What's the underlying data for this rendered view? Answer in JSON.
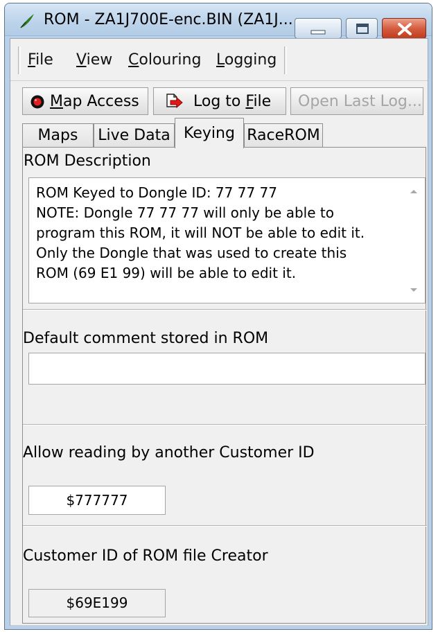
{
  "window": {
    "title": "ROM - ZA1J700E-enc.BIN (ZA1J...",
    "icon": "quill-icon",
    "controls": {
      "minimize": "minimize-icon",
      "maximize": "maximize-icon",
      "close": "close-icon"
    }
  },
  "menubar": {
    "items": [
      {
        "label": "File",
        "access_key": "F"
      },
      {
        "label": "View",
        "access_key": "V"
      },
      {
        "label": "Colouring",
        "access_key": "C"
      },
      {
        "label": "Logging",
        "access_key": "L"
      }
    ]
  },
  "toolbar": {
    "map_access": {
      "label_prefix": "",
      "access_key": "M",
      "label_suffix": "ap Access",
      "icon": "record-icon"
    },
    "log_to_file": {
      "label_prefix": "Log to ",
      "access_key": "F",
      "label_suffix": "ile",
      "icon": "log-arrow-icon"
    },
    "open_last_log": {
      "label": "Open Last Log...",
      "enabled": false
    }
  },
  "tabs": [
    {
      "label": "Maps"
    },
    {
      "label": "Live Data"
    },
    {
      "label": "Keying",
      "active": true
    },
    {
      "label": "RaceROM"
    }
  ],
  "keying": {
    "rom_description": {
      "label": "ROM Description",
      "value": "ROM Keyed to Dongle ID: 77 77 77\nNOTE: Dongle 77 77 77 will only be able to\nprogram this ROM, it will NOT be able to edit it.\nOnly the Dongle that was used to create this\nROM (69 E1 99) will be able to edit it."
    },
    "default_comment": {
      "label": "Default comment stored in ROM",
      "value": ""
    },
    "allow_reading": {
      "label": "Allow reading by another Customer ID",
      "value": "$777777"
    },
    "creator": {
      "label": "Customer ID of ROM file Creator",
      "value": "$69E199"
    }
  },
  "colors": {
    "title_bar": "#b8d0e8",
    "close_button": "#d45b3d",
    "client_background": "#f0f0f0"
  }
}
